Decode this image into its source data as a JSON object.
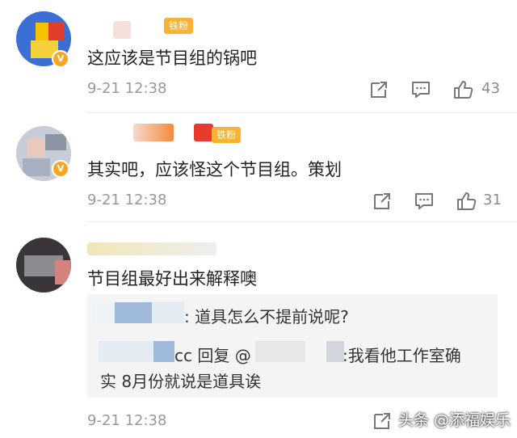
{
  "comments": [
    {
      "text": "这应该是节目组的锅吧",
      "badge": "铁粉",
      "time": "9-21 12:38",
      "likes": "43",
      "verified": "V"
    },
    {
      "text": "其实吧，应该怪这个节目组。策划",
      "badge": "铁粉",
      "time": "9-21 12:38",
      "likes": "31",
      "verified": "V"
    },
    {
      "text": "节目组最好出来解释噢",
      "time": "9-21 12:38",
      "replies": {
        "line1": ": 道具怎么不提前说呢?",
        "line2_mid": "cc 回复 @",
        "line2_end": ":我看他工作室确",
        "line3": "实 8月份就说是道具诶"
      }
    }
  ],
  "watermark": "头条 @添福娱乐",
  "icons": {
    "share": "share-icon",
    "comment": "comment-icon",
    "like": "thumbs-up-icon"
  },
  "colors": {
    "badge": "#f9b233",
    "verified": "#f5a623",
    "time": "#999999"
  }
}
